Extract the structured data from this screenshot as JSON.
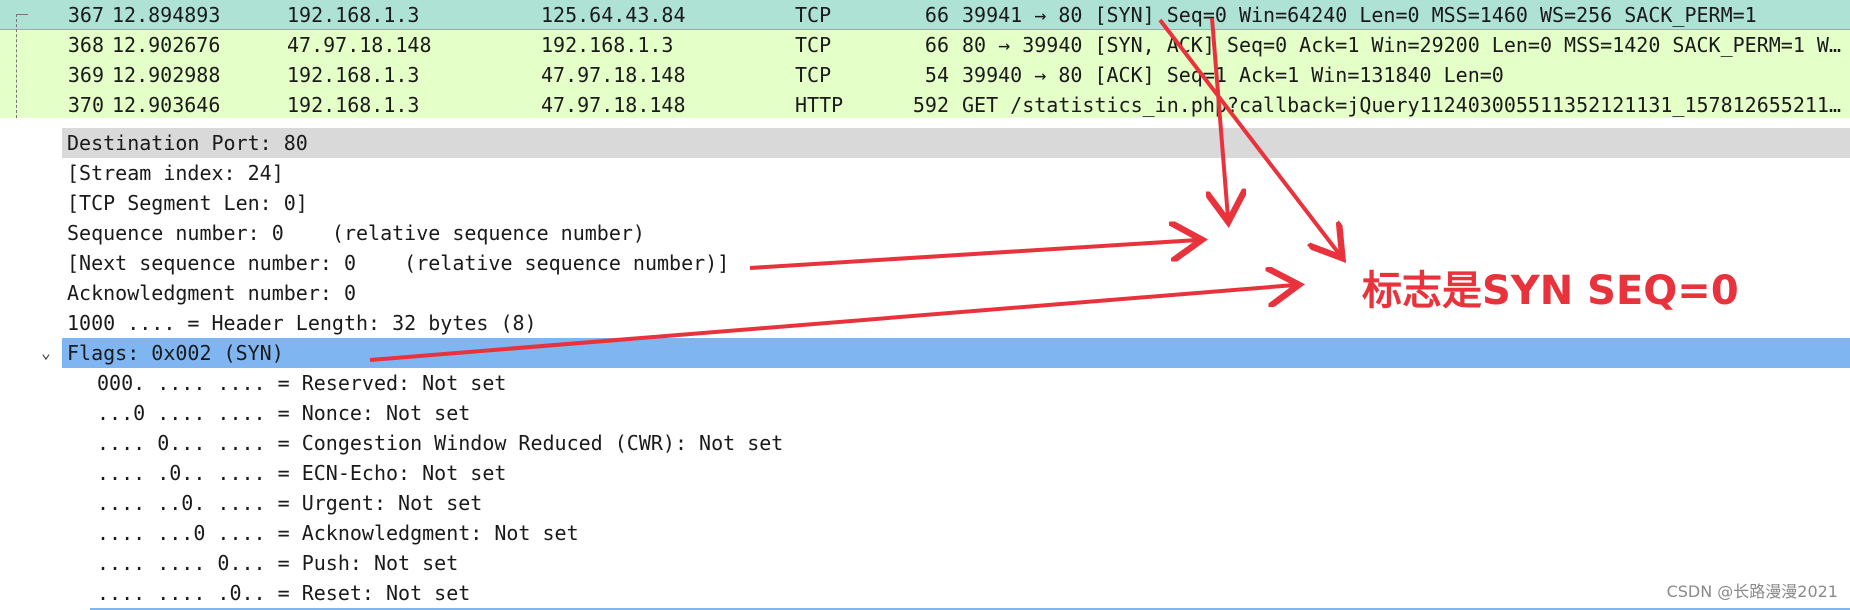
{
  "packet_list": {
    "rows": [
      {
        "no": "367",
        "time": "12.894893",
        "source": "192.168.1.3",
        "destination": "125.64.43.84",
        "protocol": "TCP",
        "length": "66",
        "info": "39941 → 80 [SYN] Seq=0 Win=64240 Len=0 MSS=1460 WS=256 SACK_PERM=1"
      },
      {
        "no": "368",
        "time": "12.902676",
        "source": "47.97.18.148",
        "destination": "192.168.1.3",
        "protocol": "TCP",
        "length": "66",
        "info": "80 → 39940 [SYN, ACK] Seq=0 Ack=1 Win=29200 Len=0 MSS=1420 SACK_PERM=1 W…"
      },
      {
        "no": "369",
        "time": "12.902988",
        "source": "192.168.1.3",
        "destination": "47.97.18.148",
        "protocol": "TCP",
        "length": "54",
        "info": "39940 → 80 [ACK] Seq=1 Ack=1 Win=131840 Len=0"
      },
      {
        "no": "370",
        "time": "12.903646",
        "source": "192.168.1.3",
        "destination": "47.97.18.148",
        "protocol": "HTTP",
        "length": "592",
        "info": "GET /statistics_in.php?callback=jQuery112403005511352121131_157812655211…"
      }
    ]
  },
  "detail": {
    "dest_port": "Destination Port: 80",
    "stream_index": "[Stream index: 24]",
    "segment_len": "[TCP Segment Len: 0]",
    "seq_number": "Sequence number: 0    (relative sequence number)",
    "next_seq": "[Next sequence number: 0    (relative sequence number)]",
    "ack_number": "Acknowledgment number: 0",
    "header_length": "1000 .... = Header Length: 32 bytes (8)",
    "expand_arrow": "⌄",
    "flags": "Flags: 0x002 (SYN)",
    "flag_bits": [
      "000. .... .... = Reserved: Not set",
      "...0 .... .... = Nonce: Not set",
      ".... 0... .... = Congestion Window Reduced (CWR): Not set",
      ".... .0.. .... = ECN-Echo: Not set",
      ".... ..0. .... = Urgent: Not set",
      ".... ...0 .... = Acknowledgment: Not set",
      ".... .... 0... = Push: Not set",
      ".... .... .0.. = Reset: Not set"
    ]
  },
  "annotation": {
    "text": "标志是SYN SEQ=0",
    "color": "#e8323c"
  },
  "watermark": "CSDN @长路漫漫2021",
  "colors": {
    "tcp_row_bg": "#e4ffc7",
    "selected_row_bg": "#ade2d5",
    "flags_selected_bg": "#7fb5f1",
    "header_gray": "#d9d9d9"
  }
}
